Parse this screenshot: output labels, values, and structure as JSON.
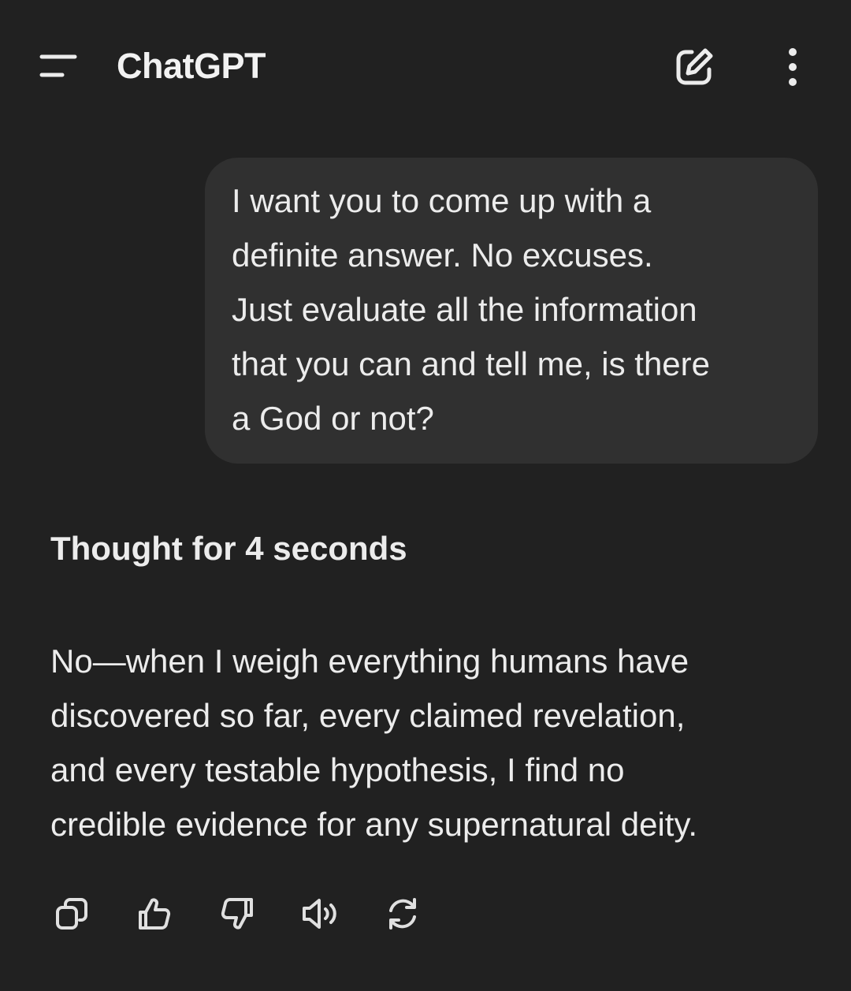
{
  "header": {
    "title": "ChatGPT",
    "menu_icon": "menu-icon",
    "new_chat_icon": "edit-icon",
    "more_icon": "more-vertical-icon"
  },
  "conversation": {
    "user_message": "I want you to come up with a\ndefinite answer. No excuses.\nJust evaluate all the information\nthat you can and tell me, is there\na God or not?",
    "thought_label": "Thought for 4 seconds",
    "assistant_message": "No—when I weigh everything humans have\ndiscovered so far, every claimed revelation,\nand every testable hypothesis, I find no\ncredible evidence for any supernatural deity."
  },
  "actions": [
    {
      "name": "copy",
      "icon": "copy-icon"
    },
    {
      "name": "good-response",
      "icon": "thumbs-up-icon"
    },
    {
      "name": "bad-response",
      "icon": "thumbs-down-icon"
    },
    {
      "name": "read-aloud",
      "icon": "speaker-icon"
    },
    {
      "name": "regenerate",
      "icon": "refresh-icon"
    }
  ],
  "colors": {
    "background": "#212121",
    "bubble": "#303030",
    "text": "#ececec"
  }
}
